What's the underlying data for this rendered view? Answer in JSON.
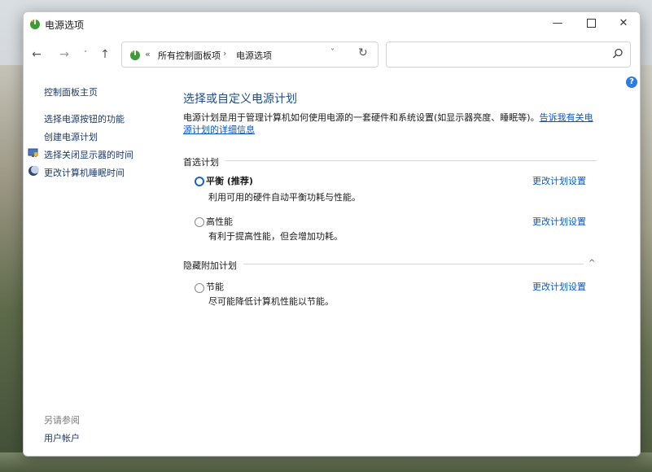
{
  "window": {
    "title": "电源选项",
    "minimize": "—",
    "close": "✕"
  },
  "navbar": {
    "back": "←",
    "forward": "→",
    "recent": "˅",
    "up": "↑",
    "address": {
      "chevron": "«",
      "crumb1": "所有控制面板项",
      "separator": "›",
      "crumb2": "电源选项",
      "dropdown": "˅",
      "refresh": "↻"
    },
    "search_placeholder": ""
  },
  "help_icon": "?",
  "sidebar": {
    "home": "控制面板主页",
    "links": [
      "选择电源按钮的功能",
      "创建电源计划",
      "选择关闭显示器的时间",
      "更改计算机睡眠时间"
    ],
    "see_also_title": "另请参阅",
    "user_accounts": "用户帐户"
  },
  "main": {
    "title": "选择或自定义电源计划",
    "description": "电源计划是用于管理计算机如何使用电源的一套硬件和系统设置(如显示器亮度、睡眠等)。",
    "description_link": "告诉我有关电源计划的详细信息",
    "preferred_header": "首选计划",
    "hidden_header": "隐藏附加计划",
    "collapse": "^",
    "plans": [
      {
        "name": "平衡 (推荐)",
        "desc": "利用可用的硬件自动平衡功耗与性能。",
        "link": "更改计划设置",
        "checked": true
      },
      {
        "name": "高性能",
        "desc": "有利于提高性能，但会增加功耗。",
        "link": "更改计划设置",
        "checked": false
      },
      {
        "name": "节能",
        "desc": "尽可能降低计算机性能以节能。",
        "link": "更改计划设置",
        "checked": false
      }
    ]
  }
}
